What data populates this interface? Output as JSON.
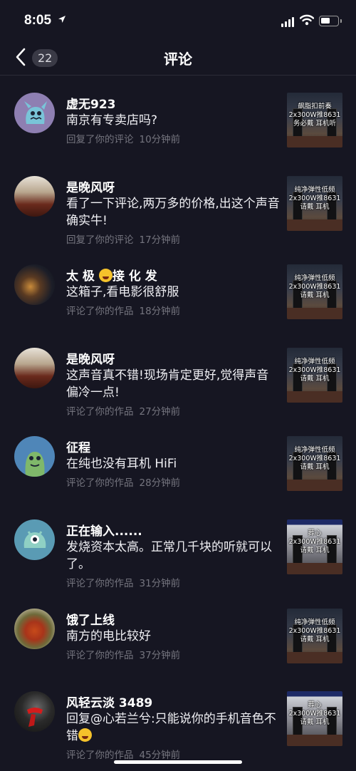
{
  "status": {
    "time": "8:05"
  },
  "nav": {
    "back_count": "22",
    "title": "评论"
  },
  "comments": [
    {
      "user": "虚无923",
      "text": "南京有专卖店吗?",
      "action": "回复了你的评论",
      "time": "10分钟前",
      "thumb": "飙脂扣前奏\n2x300W推8631\n务必戴  耳机听",
      "avatar": "monster-avatar"
    },
    {
      "user": "是晚风呀",
      "text": "看了一下评论,两万多的价格,出这个声音确实牛!",
      "action": "回复了你的评论",
      "time": "17分钟前",
      "thumb": "纯净弹性低频\n2x300W推8631\n请戴  耳机",
      "avatar": "room-avatar"
    },
    {
      "user": "太 极",
      "user_suffix": "接 化 发",
      "text": "这箱子,看电影很舒服",
      "action": "评论了你的作品",
      "time": "18分钟前",
      "thumb": "纯净弹性低频\n2x300W推8631\n请戴  耳机",
      "avatar": "city-night-avatar"
    },
    {
      "user": "是晚风呀",
      "text": "这声音真不错!现场肯定更好,觉得声音偏冷一点!",
      "action": "评论了你的作品",
      "time": "27分钟前",
      "thumb": "纯净弹性低频\n2x300W推8631\n请戴  耳机",
      "avatar": "room-avatar"
    },
    {
      "user": "征程",
      "text": "在纯也没有耳机 HiFi",
      "action": "评论了你的作品",
      "time": "28分钟前",
      "thumb": "纯净弹性低频\n2x300W推8631\n请戴  耳机",
      "avatar": "green-monster-avatar"
    },
    {
      "user": "正在输入......",
      "text": "发烧资本太高。正常几千块的听就可以了。",
      "action": "评论了你的作品",
      "time": "31分钟前",
      "thumb": "葬心\n2x300W推8631\n请戴  耳机",
      "avatar": "teal-monster-avatar"
    },
    {
      "user": "饿了上线",
      "text": "南方的电比较好",
      "action": "评论了你的作品",
      "time": "37分钟前",
      "thumb": "纯净弹性低频\n2x300W推8631\n请戴  耳机",
      "avatar": "hotpot-avatar"
    },
    {
      "user": "风轻云淡 3489",
      "text": "回复@心若兰兮:只能说你的手机音色不错",
      "action": "评论了你的作品",
      "time": "45分钟前",
      "thumb": "葬心\n2x300W推8631\n请戴  耳机",
      "avatar": "red-scarf-avatar"
    }
  ],
  "colors": {
    "background": "#161622",
    "meta": "#75757f",
    "badge": "#3a3a46"
  }
}
